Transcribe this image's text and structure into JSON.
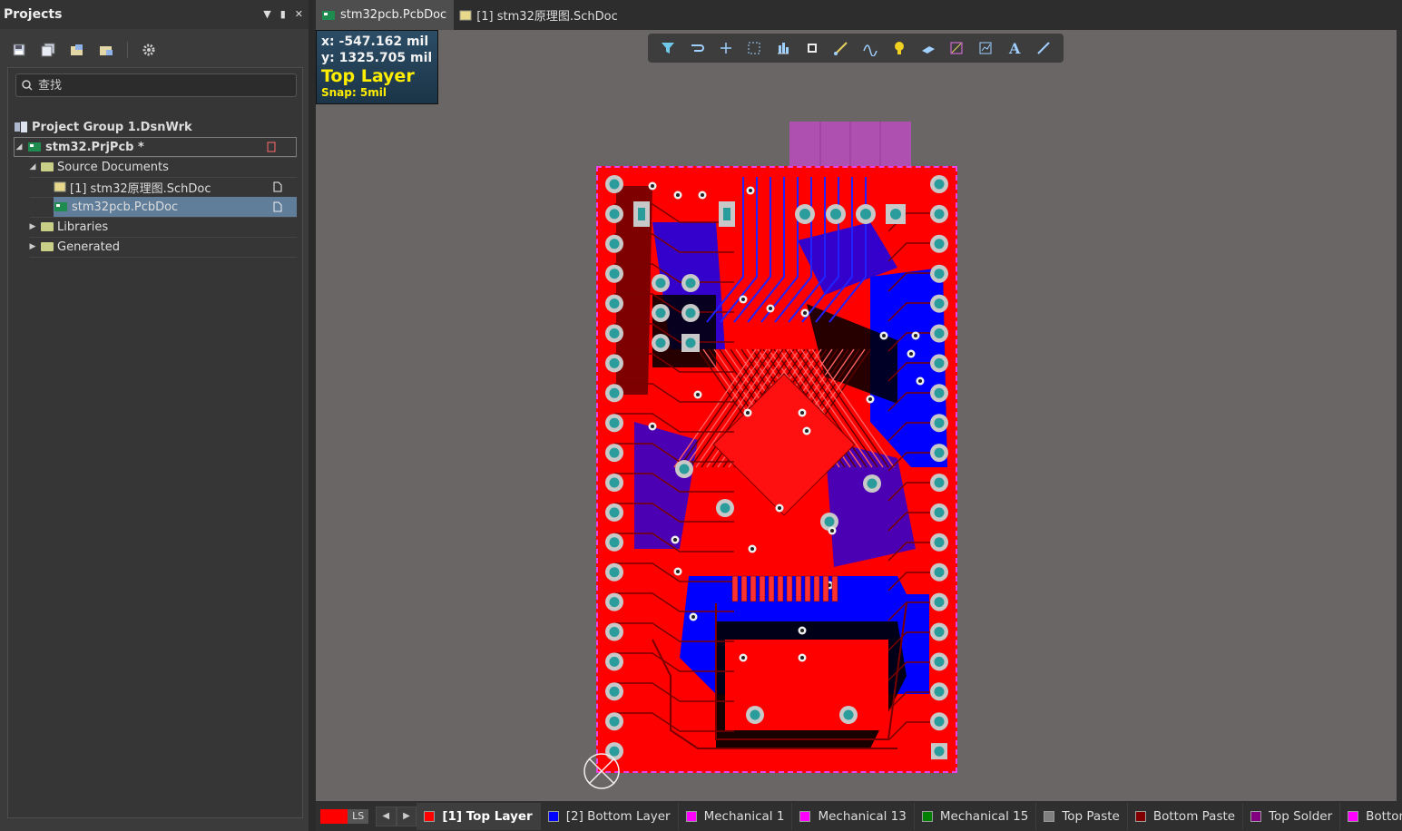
{
  "panel": {
    "title": "Projects",
    "search_placeholder": "查找",
    "tree": [
      {
        "label": "Project Group 1.DsnWrk"
      },
      {
        "label": "stm32.PrjPcb *"
      },
      {
        "label": "Source Documents"
      },
      {
        "label": "[1] stm32原理图.SchDoc"
      },
      {
        "label": "stm32pcb.PcbDoc"
      },
      {
        "label": "Libraries"
      },
      {
        "label": "Generated"
      }
    ]
  },
  "tabs": [
    {
      "label": "stm32pcb.PcbDoc"
    },
    {
      "label": "[1] stm32原理图.SchDoc"
    }
  ],
  "coords": {
    "x": "x:  -547.162  mil",
    "y": "y:  1325.705  mil",
    "layer": "Top Layer",
    "snap": "Snap: 5mil"
  },
  "layerbar": {
    "ls": "LS",
    "layers": [
      {
        "label": "[1] Top Layer",
        "color": "#ff0000"
      },
      {
        "label": "[2] Bottom Layer",
        "color": "#0000ff"
      },
      {
        "label": "Mechanical 1",
        "color": "#ff00ff"
      },
      {
        "label": "Mechanical 13",
        "color": "#ff00ff"
      },
      {
        "label": "Mechanical 15",
        "color": "#008000"
      },
      {
        "label": "Top Paste",
        "color": "#808080"
      },
      {
        "label": "Bottom Paste",
        "color": "#800000"
      },
      {
        "label": "Top Solder",
        "color": "#800080"
      },
      {
        "label": "Bottom Solder",
        "color": "#ff00ff"
      }
    ]
  },
  "colors": {
    "top_layer": "#ff0000",
    "bottom_layer": "#0000ff",
    "workspace": "#6b6666",
    "coord_layer_text": "#ffee00"
  }
}
